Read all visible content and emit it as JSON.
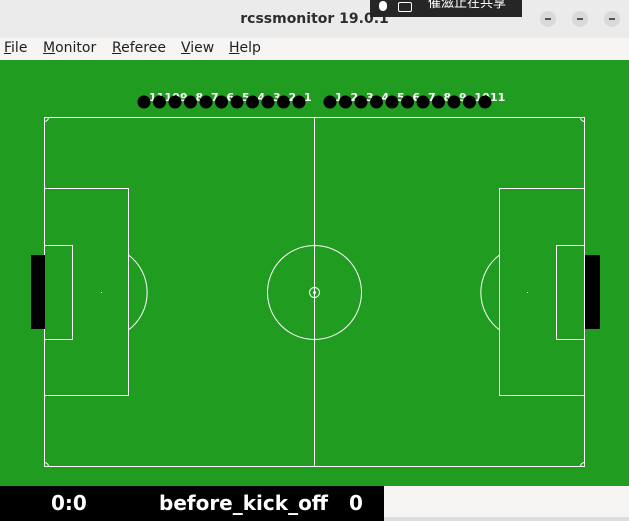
{
  "window": {
    "title": "rcssmonitor 19.0.1"
  },
  "share_banner": {
    "text": "催滋止在共享"
  },
  "menu": [
    "File",
    "Monitor",
    "Referee",
    "View",
    "Help"
  ],
  "teams": {
    "left": {
      "color": "#000000",
      "label_color": "#ffffff",
      "numbers": [
        "11",
        "10",
        "9",
        "8",
        "7",
        "6",
        "5",
        "4",
        "3",
        "2",
        "1"
      ]
    },
    "right": {
      "color": "#000000",
      "label_color": "#ffffff",
      "numbers": [
        "1",
        "2",
        "3",
        "4",
        "5",
        "6",
        "7",
        "8",
        "9",
        "10",
        "11"
      ]
    }
  },
  "field": {
    "grass_color": "#209c21",
    "line_color": "#ffffff",
    "goal_color": "#000000"
  },
  "status": {
    "score": "0:0",
    "play_mode": "before_kick_off",
    "time": "0"
  }
}
